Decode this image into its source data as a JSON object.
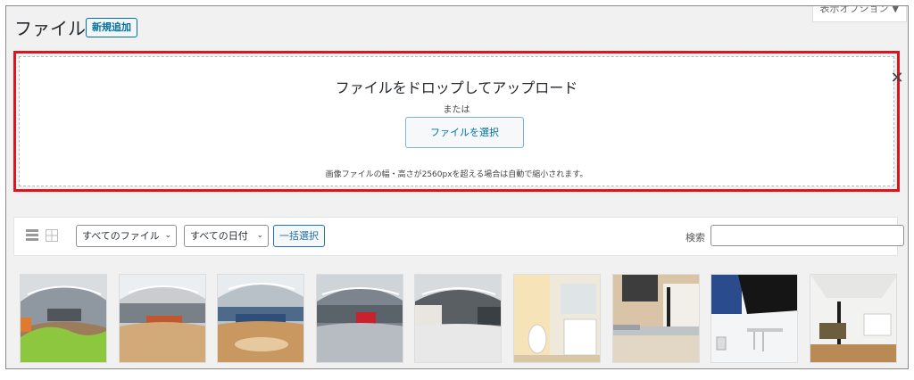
{
  "header": {
    "title": "ファイル",
    "add_new_label": "新規追加",
    "screen_options_label": "表示オプション ▼"
  },
  "uploader": {
    "title": "ファイルをドロップしてアップロード",
    "or_text": "または",
    "select_button": "ファイルを選択",
    "note": "画像ファイルの幅・高さが2560pxを超える場合は自動で縮小されます。",
    "close_label": "✕"
  },
  "toolbar": {
    "filter_type": "すべてのファイル",
    "filter_date": "すべての日付",
    "bulk_select": "一括選択",
    "search_label": "検索",
    "search_value": "",
    "chevron": "⌄"
  },
  "media": {
    "items": [
      {
        "kind": "panorama-green"
      },
      {
        "kind": "panorama-wood"
      },
      {
        "kind": "panorama-blue"
      },
      {
        "kind": "panorama-red"
      },
      {
        "kind": "panorama-white"
      },
      {
        "kind": "toilet"
      },
      {
        "kind": "kitchen"
      },
      {
        "kind": "range-hood"
      },
      {
        "kind": "living-room"
      }
    ]
  },
  "colors": {
    "accent": "#0071a1",
    "highlight_border": "#e0141a"
  }
}
